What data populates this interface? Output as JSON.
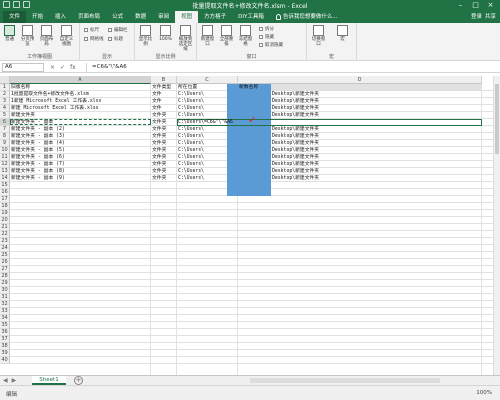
{
  "window": {
    "title": "批量提取文件名+修改文件名.xlsm - Excel"
  },
  "ribbon": {
    "tabs": [
      "文件",
      "开始",
      "插入",
      "页面布局",
      "公式",
      "数据",
      "审阅",
      "视图",
      "方方格子",
      "DIY工具箱"
    ],
    "active_tab": "视图",
    "tell_me": "告诉我您想要做什么...",
    "signin": "登录",
    "share": "共享",
    "groups": {
      "workbook_views": {
        "name": "工作簿视图",
        "buttons": [
          "普通",
          "分页预览",
          "页面布局",
          "自定义视图"
        ]
      },
      "show": {
        "name": "显示",
        "items": [
          "标尺",
          "编辑栏",
          "网格线",
          "标题"
        ]
      },
      "zoom": {
        "name": "显示比例",
        "buttons": [
          "显示比例",
          "100%",
          "缩放到选定区域"
        ]
      },
      "window": {
        "name": "窗口",
        "buttons": [
          "新建窗口",
          "全部重排",
          "冻结窗格"
        ],
        "small": [
          "拆分",
          "隐藏",
          "取消隐藏"
        ]
      },
      "macros": {
        "name": "宏",
        "buttons": [
          "切换窗口",
          "宏"
        ]
      }
    }
  },
  "formula_bar": {
    "name_box": "A6",
    "cancel": "×",
    "enter": "✓",
    "fx": "fx",
    "formula": "=C6&\"\\\"&A6"
  },
  "columns": [
    {
      "label": "A",
      "sel": true
    },
    {
      "label": "B",
      "sel": false
    },
    {
      "label": "C",
      "sel": false
    },
    {
      "label": "D",
      "sel": false
    }
  ],
  "rows": [
    "1",
    "2",
    "3",
    "4",
    "5",
    "6",
    "7",
    "8",
    "9",
    "10",
    "11",
    "12",
    "13",
    "14",
    "15",
    "16",
    "17",
    "18",
    "19",
    "20",
    "21",
    "22",
    "23",
    "24",
    "25",
    "26",
    "27",
    "28",
    "29",
    "30",
    "31",
    "32",
    "33",
    "34",
    "35",
    "36",
    "37",
    "38",
    "39",
    "40"
  ],
  "selected_row": "6",
  "cells": {
    "headers": [
      "旧版名称",
      "文件类型",
      "所在位置",
      "新数名称"
    ],
    "data": [
      [
        "1批量提取文件名+修改文件名.xlsm",
        "文件",
        "C:\\Users\\",
        "Desktop\\新建文件夹"
      ],
      [
        "1新建 Microsoft Excel 工作表.xlsx",
        "文件",
        "C:\\Users\\",
        "Desktop\\新建文件夹"
      ],
      [
        "新建 Microsoft Excel 工作表.xlsx",
        "文件",
        "C:\\Users\\",
        "Desktop\\新建文件夹"
      ],
      [
        "新建文件夹",
        "文件夹",
        "C:\\Users\\",
        "Desktop\\新建文件夹"
      ],
      [
        "新建文件夹 - 副本",
        "文件夹",
        "C:\\Users\\=C6&\"\\\"&A6",
        ""
      ],
      [
        "新建文件夹 - 副本 (2)",
        "文件夹",
        "C:\\Users\\",
        "Desktop\\新建文件夹"
      ],
      [
        "新建文件夹 - 副本 (3)",
        "文件夹",
        "C:\\Users\\",
        "Desktop\\新建文件夹"
      ],
      [
        "新建文件夹 - 副本 (4)",
        "文件夹",
        "C:\\Users\\",
        "Desktop\\新建文件夹"
      ],
      [
        "新建文件夹 - 副本 (5)",
        "文件夹",
        "C:\\Users\\",
        "Desktop\\新建文件夹"
      ],
      [
        "新建文件夹 - 副本 (6)",
        "文件夹",
        "C:\\Users\\",
        "Desktop\\新建文件夹"
      ],
      [
        "新建文件夹 - 副本 (7)",
        "文件夹",
        "C:\\Users\\",
        "Desktop\\新建文件夹"
      ],
      [
        "新建文件夹 - 副本 (8)",
        "文件夹",
        "C:\\Users\\",
        "Desktop\\新建文件夹"
      ],
      [
        "新建文件夹 - 副本 (9)",
        "文件夹",
        "C:\\Users\\",
        "Desktop\\新建文件夹"
      ]
    ]
  },
  "sheet_tabs": {
    "sheets": [
      "Sheet1"
    ],
    "add": "+"
  },
  "status": {
    "mode": "编辑",
    "zoom": "100%"
  },
  "colors": {
    "accent": "#217346",
    "blue_block": "#5b9bd5",
    "check": "#e02020"
  }
}
